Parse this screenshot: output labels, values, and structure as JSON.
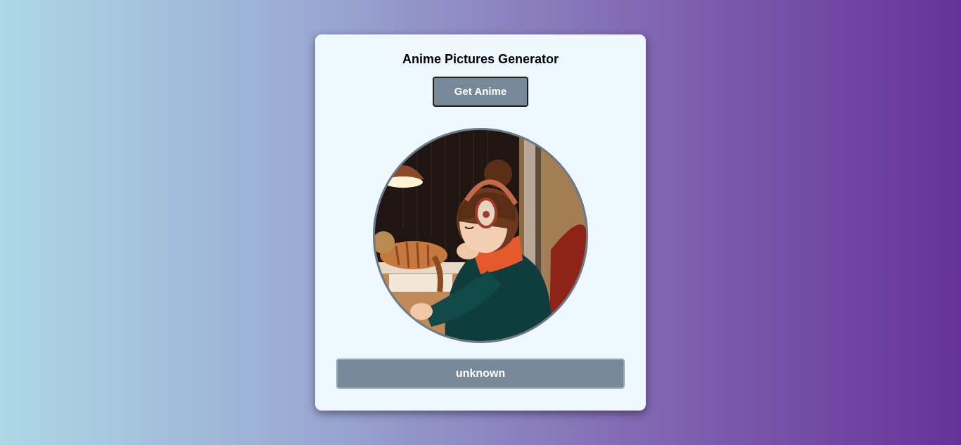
{
  "app": {
    "title": "Anime Pictures Generator"
  },
  "controls": {
    "get_button_label": "Get Anime"
  },
  "image": {
    "icon": "anime-image",
    "alt": "anime"
  },
  "result": {
    "name": "unknown"
  },
  "colors": {
    "accent": "#778899",
    "card_background": "#f0f8ff",
    "gradient_start": "#add8e6",
    "gradient_end": "#663399"
  }
}
